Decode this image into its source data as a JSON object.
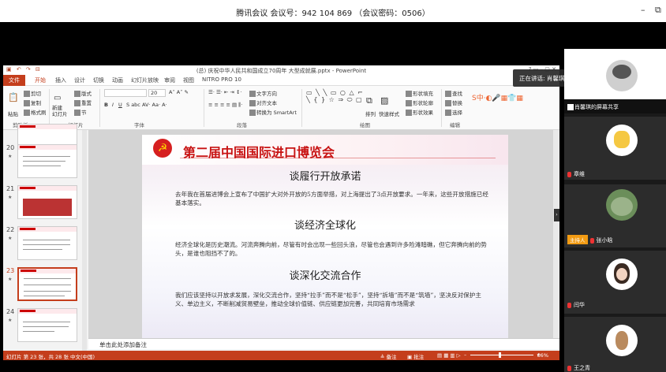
{
  "meeting": {
    "title": "腾讯会议 会议号：942 104 869 （会议密码：0506）",
    "minimize_icon": "minimize-icon",
    "restore_icon": "restore-icon",
    "speaking_label": "正在讲话: 肖馨琪;"
  },
  "ppt": {
    "window_title": "(总) 庆祝中华人民共和国成立70周年 大型成就展.pptx - PowerPoint",
    "tabs": [
      "文件",
      "开始",
      "插入",
      "设计",
      "切换",
      "动画",
      "幻灯片放映",
      "审阅",
      "视图",
      "NITRO PRO 10"
    ],
    "active_tab": "开始",
    "ribbon": {
      "paste": "粘贴",
      "cut": "剪切",
      "copy": "复制",
      "format_painter": "格式刷",
      "new_slide": "新建\n幻灯片",
      "layout": "版式",
      "reset": "重置",
      "section": "节",
      "font_size": "20",
      "text_direction": "文字方向",
      "align_text": "对齐文本",
      "smartart": "转换为 SmartArt",
      "arrange": "排列",
      "quick_styles": "快速样式",
      "shape_fill": "形状填充",
      "shape_outline": "形状轮廓",
      "shape_effects": "形状效果",
      "find": "查找",
      "replace": "替换",
      "select": "选择",
      "groups": {
        "clipboard": "剪贴板",
        "slides": "幻灯片",
        "font": "字体",
        "paragraph": "段落",
        "drawing": "绘图",
        "editing": "编辑"
      }
    },
    "thumbnails": [
      {
        "num": "20",
        "selected": false
      },
      {
        "num": "21",
        "selected": false
      },
      {
        "num": "22",
        "selected": false
      },
      {
        "num": "23",
        "selected": true
      },
      {
        "num": "24",
        "selected": false
      }
    ],
    "slide": {
      "header_title": "第二届中国国际进口博览会",
      "section1_title": "谈履行开放承诺",
      "section1_text": "去年我在首届进博会上宣布了中国扩大对外开放的5方面举措，对上海提出了3点开放要求。一年来，这些开放措施已经基本落实。",
      "section2_title": "谈经济全球化",
      "section2_text": "经济全球化是历史潮流。河流奔腾向前，尽管有时会出现一些回头浪，尽管也会遇到许多险滩暗礁，但它奔腾向前的势头，是谁也阻挡不了的。",
      "section3_title": "谈深化交流合作",
      "section3_text": "我们应该坚持以开放求发展，深化交流合作，坚持“拉手”而不是“松手”，坚持“拆墙”而不是“筑墙”，坚决反对保护主义、单边主义，不断削减贸易壁垒，推动全球价值链、供应链更加完善，共同培育市场需求"
    },
    "notes_placeholder": "单击此处添加备注",
    "status": {
      "slide_info": "幻灯片 第 23 张，共 28 张    中文(中国)",
      "notes": "备注",
      "comments": "批注",
      "zoom": "66%"
    }
  },
  "participants": [
    {
      "name": "肖馨琪的屏幕共享",
      "host": false
    },
    {
      "name": "章维",
      "host": false
    },
    {
      "name": "张小晗",
      "host": true,
      "host_label": "主持人"
    },
    {
      "name": "闫华",
      "host": false
    },
    {
      "name": "王之青",
      "host": false
    }
  ],
  "colors": {
    "ppt_accent": "#c43e1c",
    "slide_title_red": "#c81313",
    "host_badge": "#f29b13"
  }
}
